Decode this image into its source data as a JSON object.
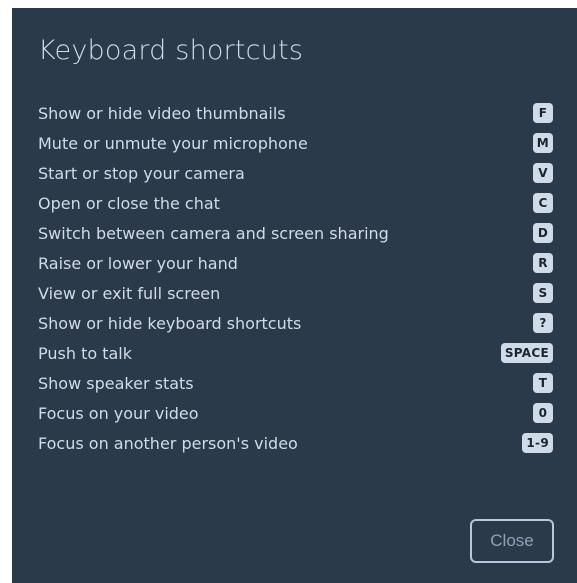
{
  "dialog": {
    "title": "Keyboard shortcuts",
    "close_label": "Close"
  },
  "shortcuts": [
    {
      "label": "Show or hide video thumbnails",
      "key": "F"
    },
    {
      "label": "Mute or unmute your microphone",
      "key": "M"
    },
    {
      "label": "Start or stop your camera",
      "key": "V"
    },
    {
      "label": "Open or close the chat",
      "key": "C"
    },
    {
      "label": "Switch between camera and screen sharing",
      "key": "D"
    },
    {
      "label": "Raise or lower your hand",
      "key": "R"
    },
    {
      "label": "View or exit full screen",
      "key": "S"
    },
    {
      "label": "Show or hide keyboard shortcuts",
      "key": "?"
    },
    {
      "label": "Push to talk",
      "key": "SPACE"
    },
    {
      "label": "Show speaker stats",
      "key": "T"
    },
    {
      "label": "Focus on your video",
      "key": "0"
    },
    {
      "label": "Focus on another person's video",
      "key": "1-9"
    }
  ],
  "colors": {
    "dialog_background": "#2a3a4b",
    "text": "#d1dbe8",
    "key_background": "#d1dbe8",
    "close_border": "#b8c7e0"
  }
}
